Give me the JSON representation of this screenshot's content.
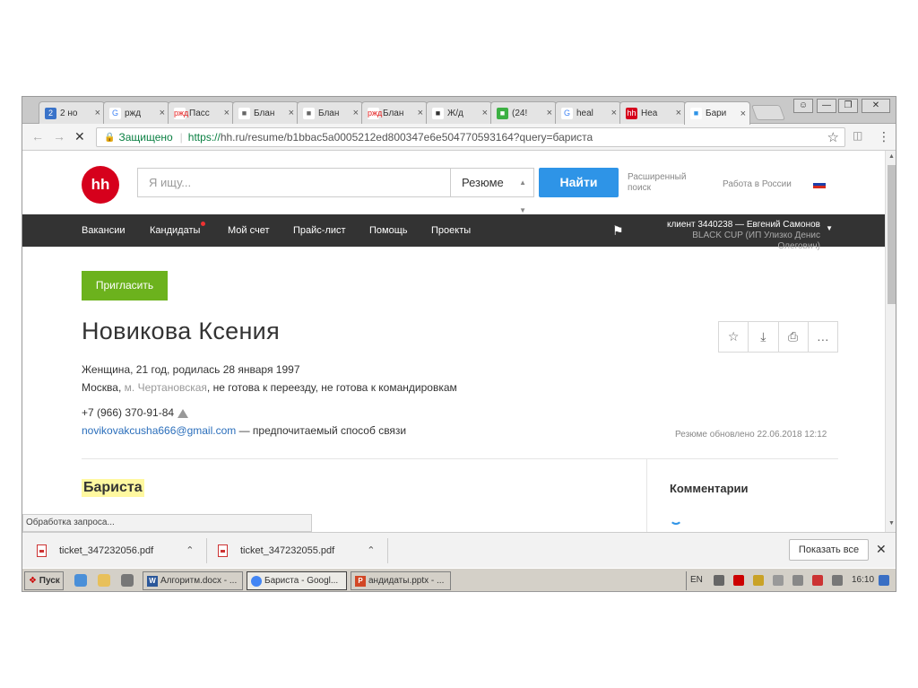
{
  "browser": {
    "tabs": [
      {
        "label": "2 но",
        "favicon": "2",
        "color": "#3a73c9",
        "text_color": "#fff"
      },
      {
        "label": "ржд",
        "favicon": "G",
        "color": "#fff",
        "text_color": "#4285f4"
      },
      {
        "label": "Пасс",
        "favicon": "ржд",
        "color": "#fff",
        "text_color": "#e21a1a"
      },
      {
        "label": "Блан",
        "favicon": "doc-icon",
        "color": "#fff",
        "text_color": "#666"
      },
      {
        "label": "Блан",
        "favicon": "doc-icon",
        "color": "#fff",
        "text_color": "#666"
      },
      {
        "label": "Блан",
        "favicon": "ржд",
        "color": "#fff",
        "text_color": "#e21a1a"
      },
      {
        "label": "Ж/д",
        "favicon": "ticket-icon",
        "color": "#fff",
        "text_color": "#333"
      },
      {
        "label": "(24!",
        "favicon": "chat-icon",
        "color": "#3cb043",
        "text_color": "#fff"
      },
      {
        "label": "heal",
        "favicon": "G",
        "color": "#fff",
        "text_color": "#4285f4"
      },
      {
        "label": "Hea",
        "favicon": "hh",
        "color": "#d6001c",
        "text_color": "#fff"
      },
      {
        "label": "Бари",
        "favicon": "spinner-icon",
        "color": "#fff",
        "text_color": "#2e94e7"
      }
    ],
    "secure_label": "Защищено",
    "url_scheme": "https://",
    "url_rest": "hh.ru/resume/b1bbac5a0005212ed800347e6e504770593164?query=бариста"
  },
  "site": {
    "logo": "hh",
    "search_placeholder": "Я ищу...",
    "search_type": "Резюме",
    "find_button": "Найти",
    "advanced_search": "Расширенный поиск",
    "work_in_russia": "Работа в России",
    "menu": [
      "Вакансии",
      "Кандидаты",
      "Мой счет",
      "Прайс-лист",
      "Помощь",
      "Проекты"
    ],
    "client_line1": "клиент 3440238 — Евгений Самонов",
    "client_line2": "BLACK CUP (ИП Улизко Денис Олегович)"
  },
  "resume": {
    "invite_button": "Пригласить",
    "name": "Новикова Ксения",
    "line1": "Женщина, 21 год, родилась 28 января 1997",
    "city": "Москва,",
    "metro": "м. Чертановская",
    "relocation": ", не готова к переезду, не готова к командировкам",
    "phone": "+7 (966) 370-91-84",
    "email": "novikovakcusha666@gmail.com",
    "email_note": " — предпочитаемый способ связи",
    "updated": "Резюме обновлено 22.06.2018 12:12",
    "position": "Бариста",
    "comments_title": "Комментарии"
  },
  "status_text": "Обработка запроса...",
  "downloads": {
    "items": [
      "ticket_347232056.pdf",
      "ticket_347232055.pdf"
    ],
    "show_all": "Показать все"
  },
  "taskbar": {
    "start": "Пуск",
    "tasks": [
      {
        "label": "Алгоритм.docx - ...",
        "icon": "W",
        "color": "#2b579a"
      },
      {
        "label": "Бариста - Googl...",
        "icon": "chrome",
        "color": "#4285f4"
      },
      {
        "label": "андидаты.pptx - ...",
        "icon": "P",
        "color": "#d24726"
      }
    ],
    "lang": "EN",
    "clock": "16:10"
  }
}
